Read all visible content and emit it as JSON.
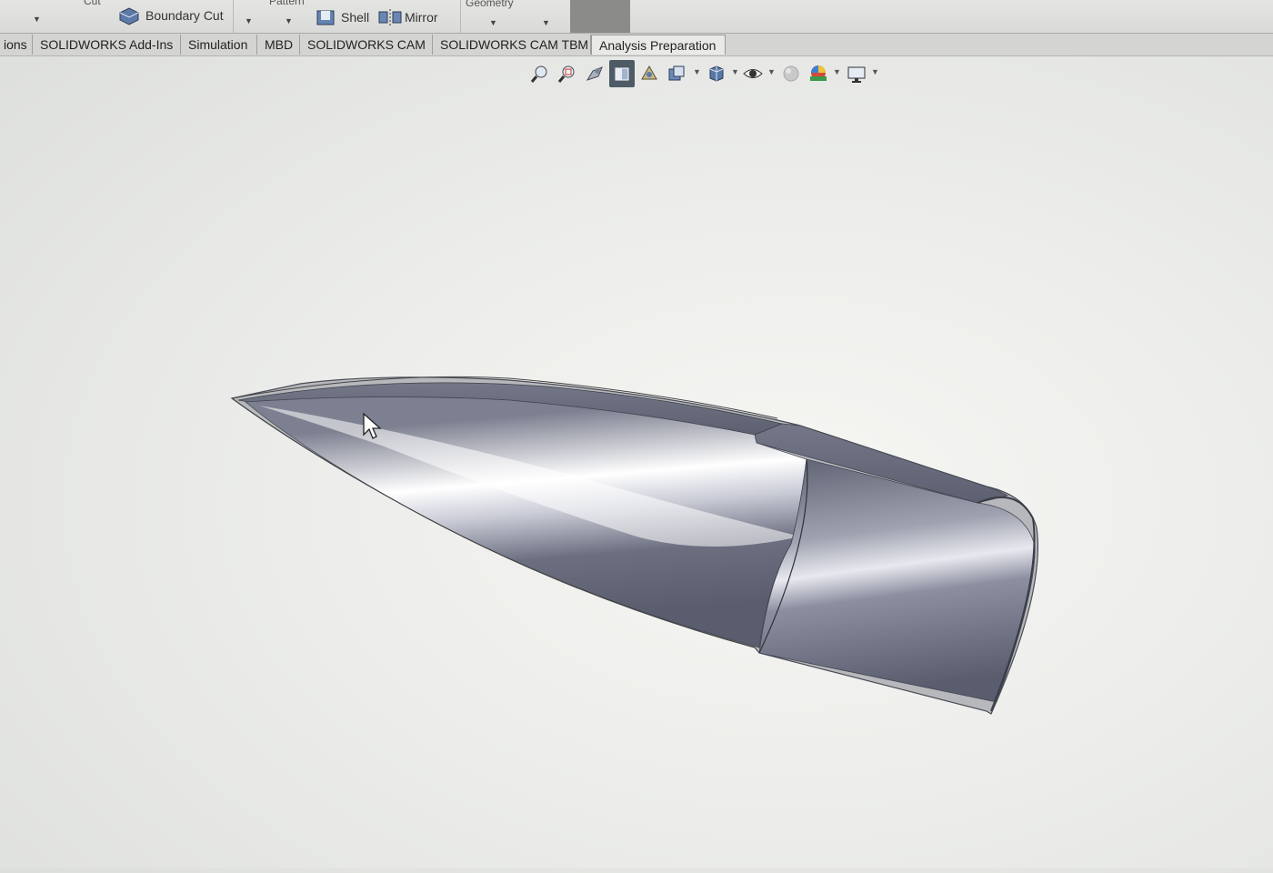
{
  "ribbon": {
    "cut_label": "Cut",
    "boundary_cut_label": "Boundary Cut",
    "pattern_label": "Pattern",
    "shell_label": "Shell",
    "mirror_label": "Mirror",
    "geometry_label": "Geometry"
  },
  "tabs": [
    {
      "label": "ions"
    },
    {
      "label": "SOLIDWORKS Add-Ins"
    },
    {
      "label": "Simulation"
    },
    {
      "label": "MBD"
    },
    {
      "label": "SOLIDWORKS CAM"
    },
    {
      "label": "SOLIDWORKS CAM TBM"
    },
    {
      "label": "Analysis Preparation"
    }
  ],
  "view_toolbar": {
    "icons": [
      "zoom-to-fit-icon",
      "zoom-to-area-icon",
      "previous-view-icon",
      "section-view-icon",
      "dynamic-annotation-icon",
      "view-orientation-icon",
      "display-style-icon",
      "hide-show-icon",
      "edit-appearance-icon",
      "apply-scene-icon",
      "view-settings-icon"
    ]
  },
  "colors": {
    "background": "#ecedea",
    "ribbon": "#dcddda",
    "model_dark": "#5f6272",
    "model_light": "#ffffff",
    "selected_tool": "#4e5a66"
  }
}
